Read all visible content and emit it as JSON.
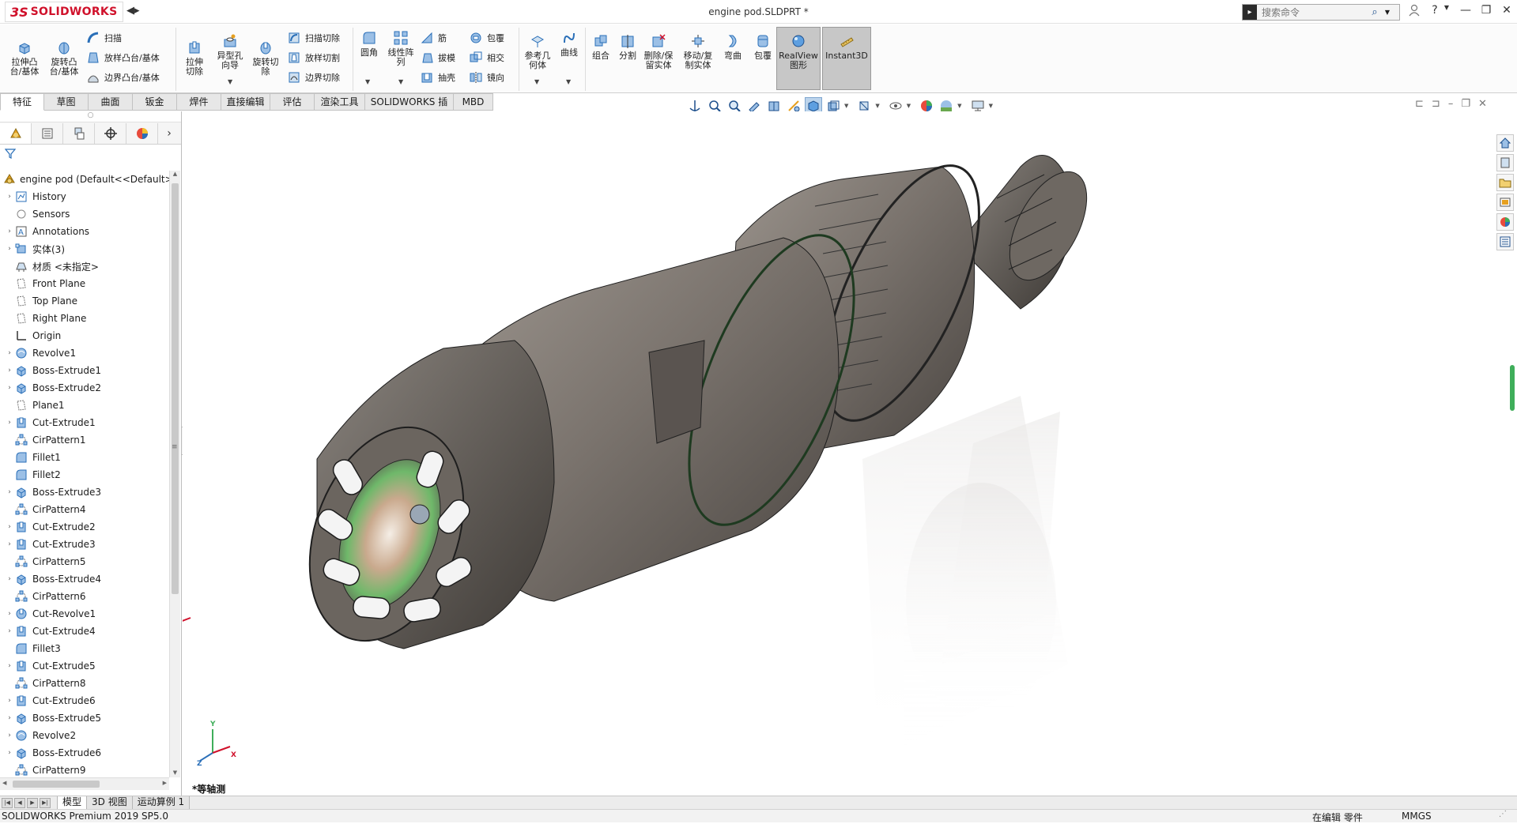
{
  "app": {
    "logo_ds": "3S",
    "logo_text": "SOLIDWORKS",
    "document_title": "engine pod.SLDPRT *",
    "search_placeholder": "搜索命令"
  },
  "ribbon": {
    "extrude_boss": "拉伸凸台/基体",
    "revolve_boss": "旋转凸台/基体",
    "sweep": "扫描",
    "loft_boss": "放样凸台/基体",
    "boundary_boss": "边界凸台/基体",
    "extrude_cut": "拉伸切除",
    "hole_wizard": "异型孔向导",
    "revolve_cut": "旋转切除",
    "sweep_cut": "扫描切除",
    "loft_cut": "放样切割",
    "boundary_cut": "边界切除",
    "fillet": "圆角",
    "linear_pattern": "线性阵列",
    "rib": "筋",
    "draft": "拔模",
    "shell": "抽壳",
    "wrap": "包覆",
    "intersect": "相交",
    "mirror": "镜向",
    "ref_geometry": "参考几何体",
    "curves": "曲线",
    "combine": "组合",
    "split": "分割",
    "delete_keep_body": "删除/保留实体",
    "move_copy_body": "移动/复制实体",
    "flex": "弯曲",
    "wrap2": "包覆",
    "realview": "RealView图形",
    "instant3d": "Instant3D"
  },
  "tabs": [
    "特征",
    "草图",
    "曲面",
    "钣金",
    "焊件",
    "直接编辑",
    "评估",
    "渲染工具",
    "SOLIDWORKS 插件",
    "MBD"
  ],
  "tree": {
    "root": "engine pod  (Default<<Default>",
    "items": [
      {
        "label": "History",
        "icon": "history-icon",
        "exp": true
      },
      {
        "label": "Sensors",
        "icon": "sensor-icon",
        "exp": false
      },
      {
        "label": "Annotations",
        "icon": "annotation-icon",
        "exp": true
      },
      {
        "label": "实体(3)",
        "icon": "solid-bodies-icon",
        "exp": true
      },
      {
        "label": "材质 <未指定>",
        "icon": "material-icon",
        "exp": false
      },
      {
        "label": "Front Plane",
        "icon": "plane-icon",
        "exp": false
      },
      {
        "label": "Top Plane",
        "icon": "plane-icon",
        "exp": false
      },
      {
        "label": "Right Plane",
        "icon": "plane-icon",
        "exp": false
      },
      {
        "label": "Origin",
        "icon": "origin-icon",
        "exp": false
      },
      {
        "label": "Revolve1",
        "icon": "revolve-icon",
        "exp": true
      },
      {
        "label": "Boss-Extrude1",
        "icon": "extrude-icon",
        "exp": true
      },
      {
        "label": "Boss-Extrude2",
        "icon": "extrude-icon",
        "exp": true
      },
      {
        "label": "Plane1",
        "icon": "plane-icon",
        "exp": false
      },
      {
        "label": "Cut-Extrude1",
        "icon": "cut-extrude-icon",
        "exp": true
      },
      {
        "label": "CirPattern1",
        "icon": "circular-pattern-icon",
        "exp": false
      },
      {
        "label": "Fillet1",
        "icon": "fillet-icon",
        "exp": false
      },
      {
        "label": "Fillet2",
        "icon": "fillet-icon",
        "exp": false
      },
      {
        "label": "Boss-Extrude3",
        "icon": "extrude-icon",
        "exp": true
      },
      {
        "label": "CirPattern4",
        "icon": "circular-pattern-icon",
        "exp": false
      },
      {
        "label": "Cut-Extrude2",
        "icon": "cut-extrude-icon",
        "exp": true
      },
      {
        "label": "Cut-Extrude3",
        "icon": "cut-extrude-icon",
        "exp": true
      },
      {
        "label": "CirPattern5",
        "icon": "circular-pattern-icon",
        "exp": false
      },
      {
        "label": "Boss-Extrude4",
        "icon": "extrude-icon",
        "exp": true
      },
      {
        "label": "CirPattern6",
        "icon": "circular-pattern-icon",
        "exp": false
      },
      {
        "label": "Cut-Revolve1",
        "icon": "cut-revolve-icon",
        "exp": true
      },
      {
        "label": "Cut-Extrude4",
        "icon": "cut-extrude-icon",
        "exp": true
      },
      {
        "label": "Fillet3",
        "icon": "fillet-icon",
        "exp": false
      },
      {
        "label": "Cut-Extrude5",
        "icon": "cut-extrude-icon",
        "exp": true
      },
      {
        "label": "CirPattern8",
        "icon": "circular-pattern-icon",
        "exp": false
      },
      {
        "label": "Cut-Extrude6",
        "icon": "cut-extrude-icon",
        "exp": true
      },
      {
        "label": "Boss-Extrude5",
        "icon": "extrude-icon",
        "exp": true
      },
      {
        "label": "Revolve2",
        "icon": "revolve-icon",
        "exp": true
      },
      {
        "label": "Boss-Extrude6",
        "icon": "extrude-icon",
        "exp": true
      },
      {
        "label": "CirPattern9",
        "icon": "circular-pattern-icon",
        "exp": false
      }
    ]
  },
  "viewport": {
    "view_label": "*等轴测",
    "triad_x": "X",
    "triad_y": "Y",
    "triad_z": "Z"
  },
  "bottom_tabs": [
    "模型",
    "3D 视图",
    "运动算例 1"
  ],
  "status": {
    "product": "SOLIDWORKS Premium 2019 SP5.0",
    "editing": "在编辑 零件",
    "units": "MMGS"
  },
  "colors": {
    "brand_red": "#d0112b",
    "feature_blue": "#2a6fb8",
    "body_gray": "#7d7670"
  }
}
